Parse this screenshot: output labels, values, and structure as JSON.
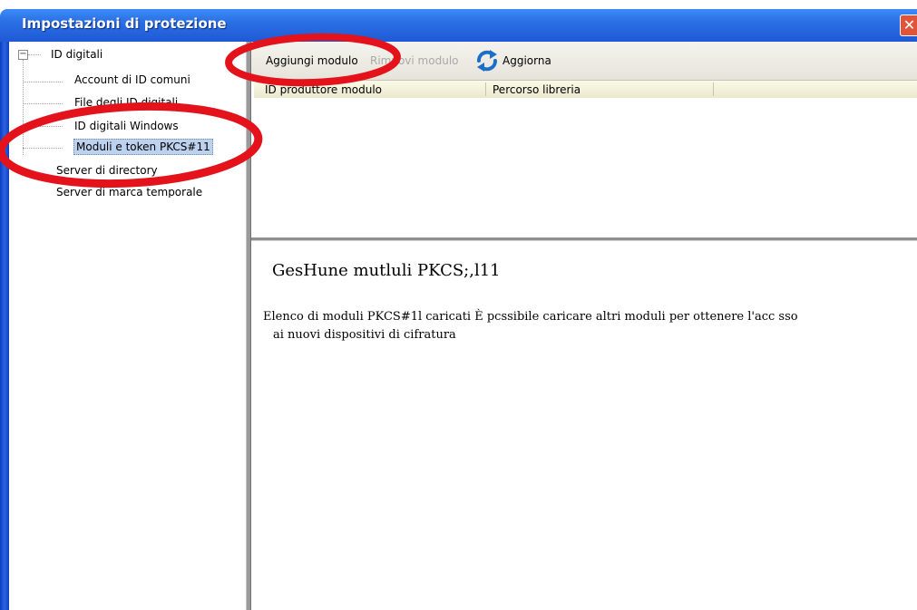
{
  "window": {
    "title": "Impostazioni di protezione",
    "close_glyph": "✕"
  },
  "sidebar": {
    "expander_glyph": "−",
    "items": [
      {
        "label": "ID digitali"
      },
      {
        "label": "Account di ID comuni"
      },
      {
        "label": "File degli ID digitali"
      },
      {
        "label": "ID digitali Windows"
      },
      {
        "label": "Moduli e token PKCS#11"
      },
      {
        "label": "Server di directory"
      },
      {
        "label": "Server di marca temporale"
      }
    ],
    "selected_index": 4
  },
  "toolbar": {
    "add_label": "Aggiungi modulo",
    "remove_label": "Rimuovi modulo",
    "refresh_label": "Aggiorna",
    "refresh_icon": "refresh-icon"
  },
  "table": {
    "columns": [
      "ID produttore modulo",
      "Percorso libreria"
    ],
    "rows": []
  },
  "description": {
    "title": "GesHune mutluli PKCS;,l11",
    "line1": "Elenco di moduli  PKCS#1l caricati È pcssibile caricare altri moduli per ottenere l'acc  sso",
    "line2": "ai nuovi dispositivi di cifratura"
  },
  "colors": {
    "titlebar": "#2a6fe3",
    "annotation": "#e3121b",
    "selected": "#bcd2ee"
  }
}
